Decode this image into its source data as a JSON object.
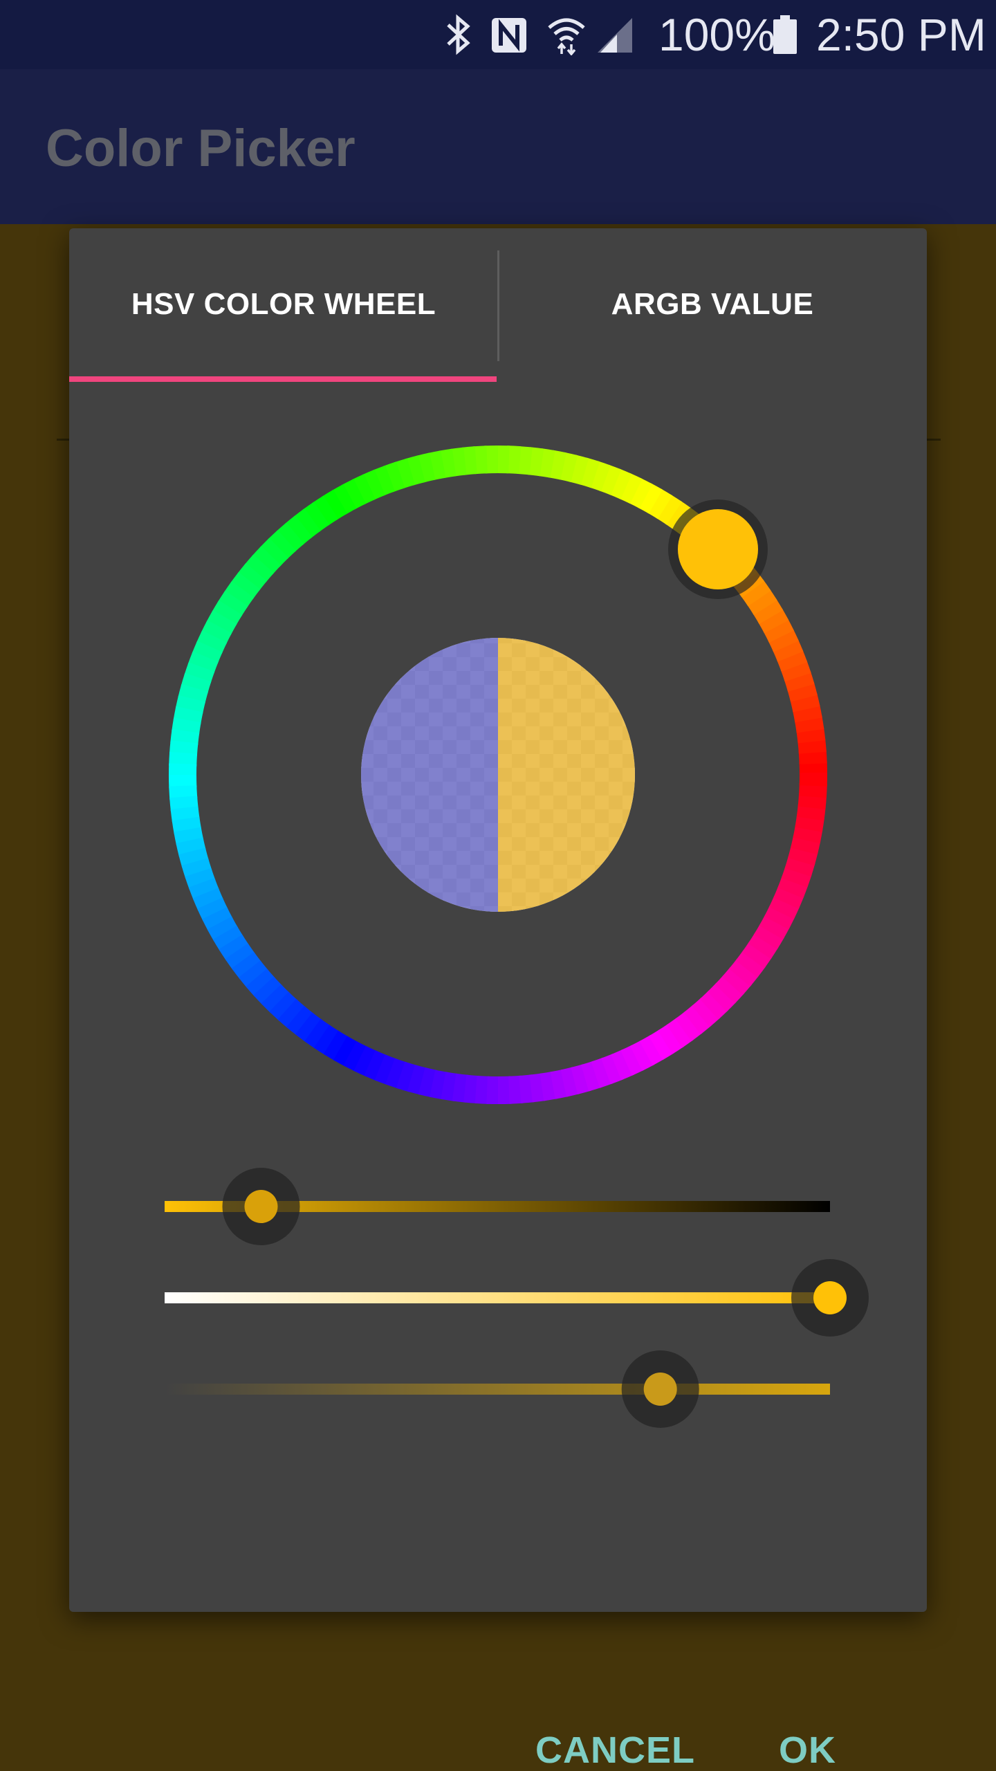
{
  "status_bar": {
    "icons": [
      "bluetooth-icon",
      "nfc-icon",
      "wifi-icon",
      "signal-icon",
      "battery-icon"
    ],
    "battery": "100%",
    "time": "2:50 PM"
  },
  "app_bar": {
    "title": "Color Picker"
  },
  "dialog": {
    "tabs": [
      {
        "label": "HSV COLOR WHEEL",
        "selected": true
      },
      {
        "label": "ARGB VALUE",
        "selected": false
      }
    ],
    "tab_indicator_color": "#f0457e",
    "wheel": {
      "selected_color": "#ffc107",
      "preview": {
        "old_color": "#6f6fc6",
        "new_color": "#e9b83d"
      }
    },
    "sliders": [
      {
        "name": "value",
        "fraction": 0.145,
        "thumb_color": "#d9a10a",
        "start_color": "#ffc107",
        "end_color": "#000000"
      },
      {
        "name": "saturation",
        "fraction": 1.0,
        "thumb_color": "#ffc107",
        "start_color": "#ffffff",
        "end_color": "#ffc107"
      },
      {
        "name": "alpha",
        "fraction": 0.745,
        "thumb_color": "#c99a1a",
        "start_color": "#424242",
        "end_color": "#d8a60e"
      }
    ],
    "buttons": {
      "cancel": "CANCEL",
      "ok": "OK"
    },
    "button_color": "#7ecdc3"
  },
  "colors": {
    "status_bar": "#141a42",
    "app_bar": "#1a1f47",
    "dialog": "#424242",
    "scrim": "#45350a"
  }
}
